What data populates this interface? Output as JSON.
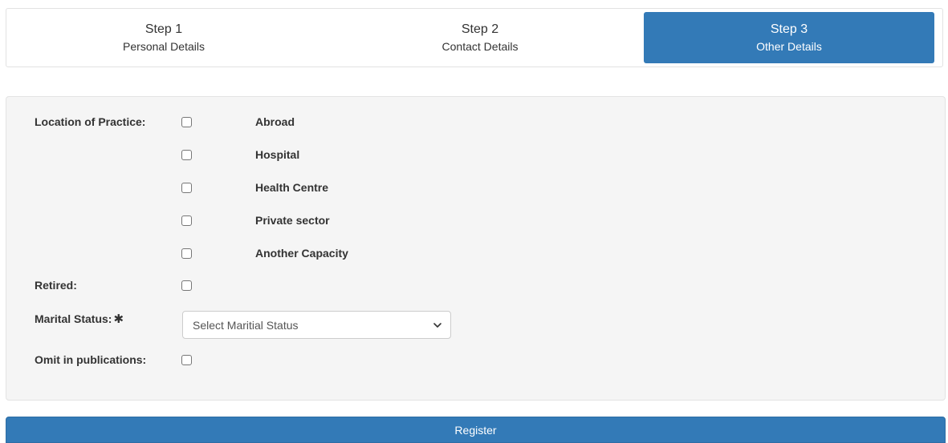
{
  "steps": [
    {
      "title": "Step 1",
      "subtitle": "Personal Details"
    },
    {
      "title": "Step 2",
      "subtitle": "Contact Details"
    },
    {
      "title": "Step 3",
      "subtitle": "Other Details"
    }
  ],
  "active_step_color": "#337ab7",
  "form": {
    "location_label": "Location of Practice:",
    "location_options": [
      "Abroad",
      "Hospital",
      "Health Centre",
      "Private sector",
      "Another Capacity"
    ],
    "retired_label": "Retired:",
    "marital_label": "Marital Status:",
    "marital_required_mark": "✱",
    "marital_placeholder": "Select Maritial Status",
    "omit_label": "Omit in publications:"
  },
  "register_label": "Register"
}
